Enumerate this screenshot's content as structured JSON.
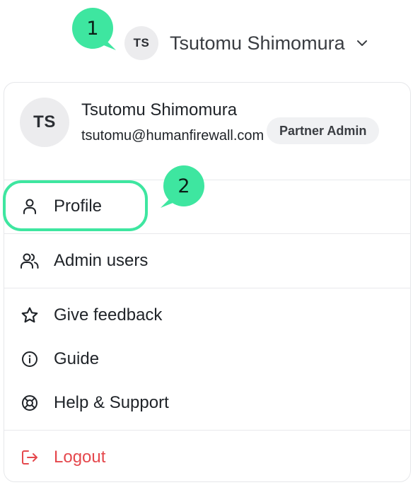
{
  "annotations": {
    "step1": "1",
    "step2": "2"
  },
  "trigger": {
    "initials": "TS",
    "name": "Tsutomu Shimomura"
  },
  "header": {
    "initials": "TS",
    "name": "Tsutomu Shimomura",
    "email": "tsutomu@humanfirewall.com",
    "role": "Partner Admin"
  },
  "menu": {
    "profile": "Profile",
    "admin_users": "Admin users",
    "give_feedback": "Give feedback",
    "guide": "Guide",
    "help_support": "Help & Support",
    "logout": "Logout"
  },
  "colors": {
    "accent_annotation": "#3ee6a0",
    "logout": "#e5484d",
    "avatar_bg": "#ececee"
  },
  "icons": {
    "profile": "user-icon",
    "admin_users": "users-icon",
    "give_feedback": "star-icon",
    "guide": "info-icon",
    "help_support": "lifebuoy-icon",
    "logout": "logout-icon"
  }
}
